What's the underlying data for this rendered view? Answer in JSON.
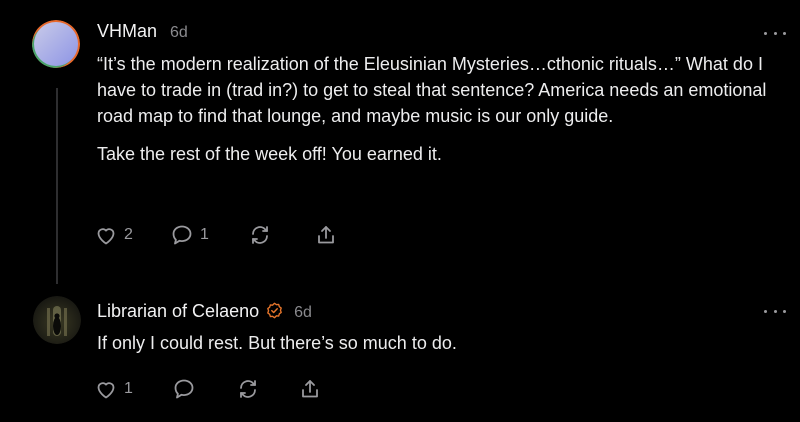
{
  "comments": [
    {
      "author": "VHMan",
      "time": "6d",
      "paragraphs": [
        "“It’s the modern realization of the Eleusinian Mysteries…cthonic rituals…” What do I have to trade in (trad in?) to get to steal that sentence? America needs an emotional road map to find that lounge, and maybe music is our only guide.",
        "Take the rest of the week off! You earned it."
      ],
      "likes": "2",
      "replies": "1",
      "icons": [
        "heart-icon",
        "comment-icon",
        "restack-icon",
        "share-icon",
        "more-icon"
      ]
    },
    {
      "author": "Librarian of Celaeno",
      "time": "6d",
      "paragraphs": [
        "If only I could rest. But there’s so much to do."
      ],
      "likes": "1",
      "verified_color": "#e8762b",
      "icons": [
        "heart-icon",
        "comment-icon",
        "restack-icon",
        "share-icon",
        "more-icon",
        "verified-badge-icon"
      ]
    }
  ]
}
